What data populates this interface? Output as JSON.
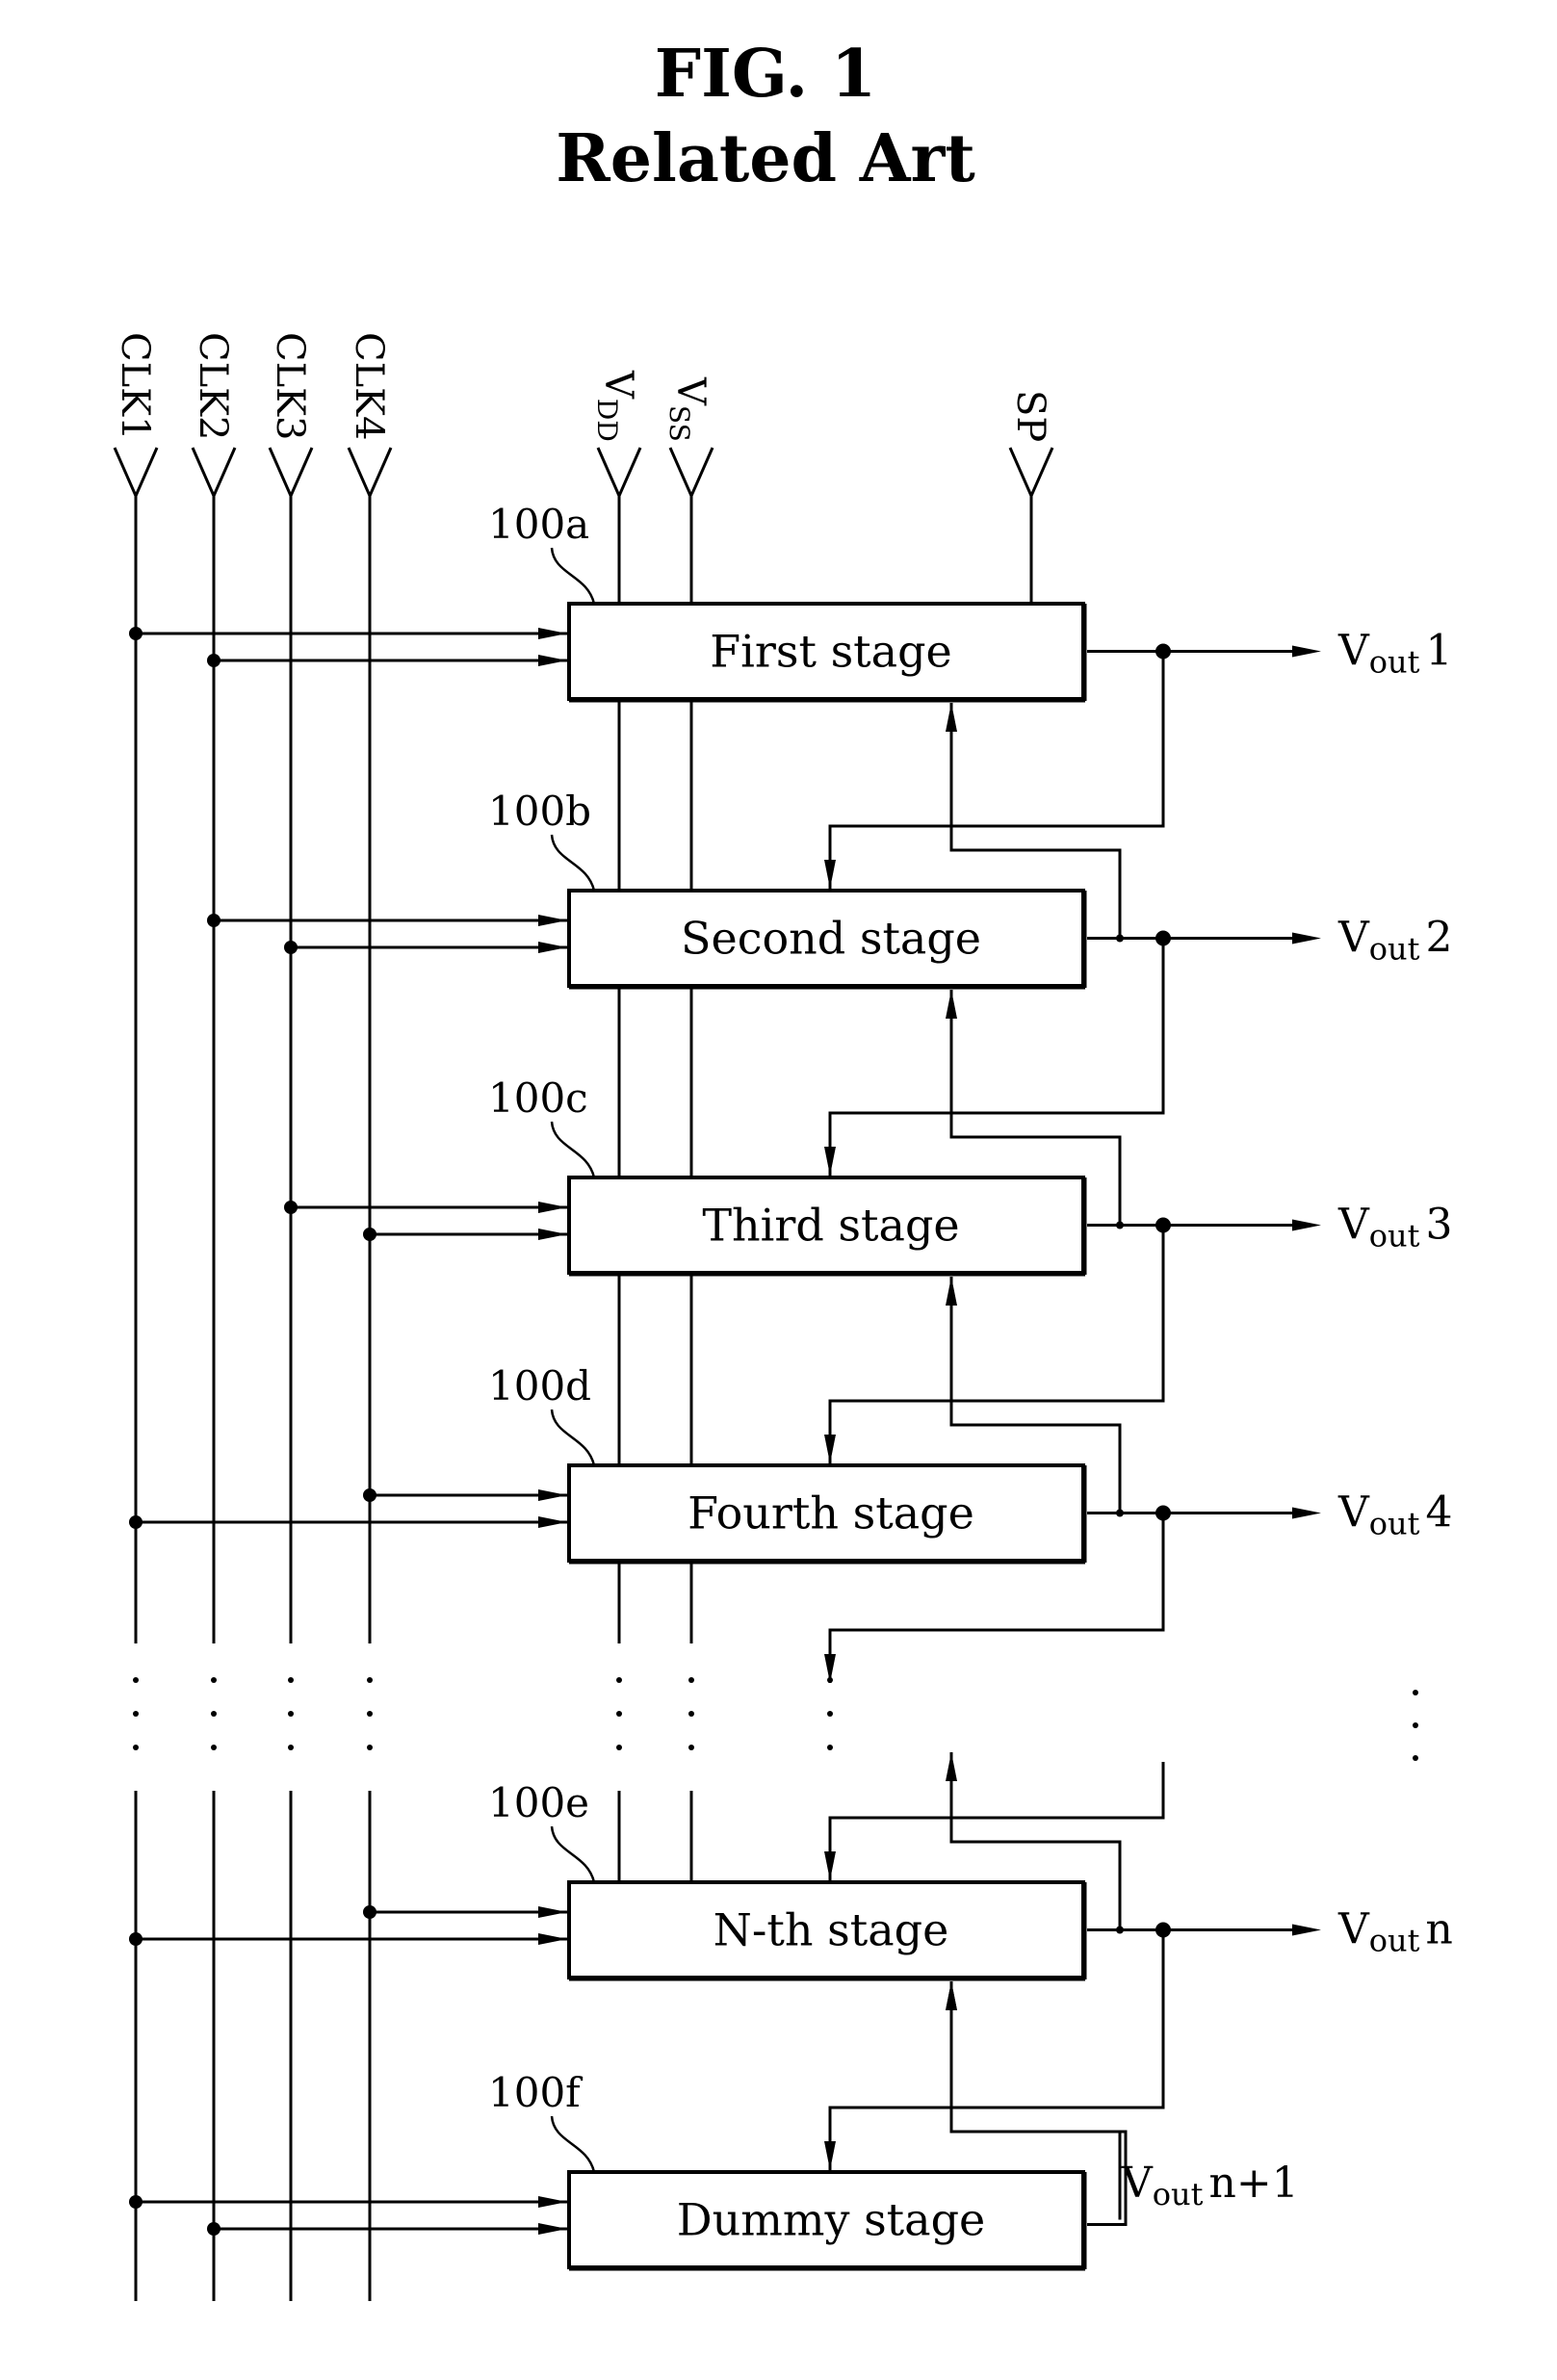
{
  "figure": {
    "title": "FIG. 1",
    "subtitle": "Related Art"
  },
  "inputs": {
    "clocks": [
      "CLK1",
      "CLK2",
      "CLK3",
      "CLK4"
    ],
    "vdd": {
      "main": "V",
      "sub": "DD"
    },
    "vss": {
      "main": "V",
      "sub": "SS"
    },
    "start_pulse": "SP"
  },
  "stages": [
    {
      "ref": "100a",
      "name": "First stage",
      "clock_inputs": [
        "CLK1",
        "CLK2"
      ],
      "output": {
        "main": "V",
        "sub": "out",
        "suffix": "1"
      }
    },
    {
      "ref": "100b",
      "name": "Second stage",
      "clock_inputs": [
        "CLK2",
        "CLK3"
      ],
      "output": {
        "main": "V",
        "sub": "out",
        "suffix": "2"
      }
    },
    {
      "ref": "100c",
      "name": "Third stage",
      "clock_inputs": [
        "CLK3",
        "CLK4"
      ],
      "output": {
        "main": "V",
        "sub": "out",
        "suffix": "3"
      }
    },
    {
      "ref": "100d",
      "name": "Fourth stage",
      "clock_inputs": [
        "CLK4",
        "CLK1"
      ],
      "output": {
        "main": "V",
        "sub": "out",
        "suffix": "4"
      }
    },
    {
      "ref": "100e",
      "name": "N-th stage",
      "clock_inputs": [
        "CLK4",
        "CLK1"
      ],
      "output": {
        "main": "V",
        "sub": "out",
        "suffix": "n"
      }
    },
    {
      "ref": "100f",
      "name": "Dummy stage",
      "clock_inputs": [
        "CLK1",
        "CLK2"
      ],
      "output": {
        "main": "V",
        "sub": "out",
        "suffix": "n+1"
      }
    }
  ],
  "ellipsis": "⋮"
}
